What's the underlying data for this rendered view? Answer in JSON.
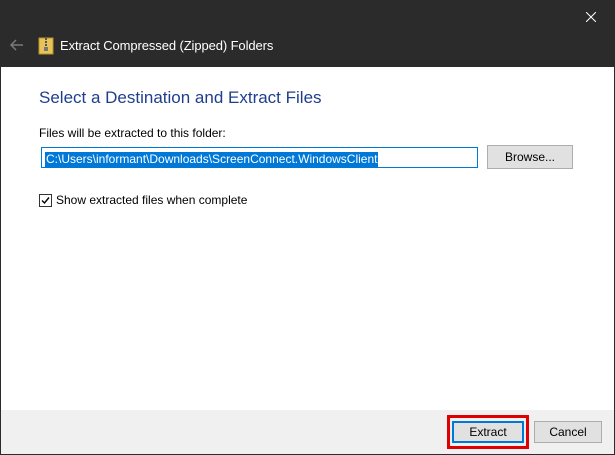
{
  "titlebar": {
    "title": "Extract Compressed (Zipped) Folders",
    "back_icon": "back-arrow-icon",
    "close_icon": "close-icon",
    "folder_icon": "zip-folder-icon",
    "background_color": "#2b2b2b"
  },
  "main": {
    "heading": "Select a Destination and Extract Files",
    "folder_label": "Files will be extracted to this folder:",
    "destination_path": "C:\\Users\\informant\\Downloads\\ScreenConnect.WindowsClient",
    "browse_label": "Browse...",
    "show_files_checkbox": {
      "label": "Show extracted files when complete",
      "checked": true
    },
    "heading_color": "#1f3e8e",
    "selection_color": "#0078d7"
  },
  "footer": {
    "extract_label": "Extract",
    "cancel_label": "Cancel",
    "highlight_color": "#e00000"
  }
}
